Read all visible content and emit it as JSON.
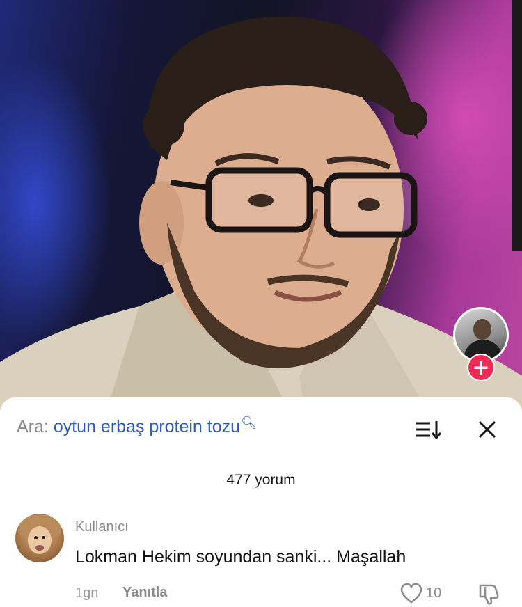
{
  "search": {
    "label": "Ara:",
    "query": "oytun erbaş protein tozu"
  },
  "comments": {
    "count_text": "477 yorum",
    "items": [
      {
        "username": "Kullanıcı",
        "text": "Lokman Hekim soyundan sanki... Maşallah",
        "time": "1gn",
        "reply_label": "Yanıtla",
        "like_count": "10"
      }
    ]
  },
  "colors": {
    "search_query": "#2f5bb7",
    "follow_button": "#ee2b55",
    "secondary_text": "#8b8b8b"
  },
  "icons": {
    "follow": "plus-icon",
    "search": "search-icon",
    "sort": "sort-icon",
    "close": "close-icon",
    "like": "heart-icon",
    "dislike": "thumbs-down-icon"
  }
}
